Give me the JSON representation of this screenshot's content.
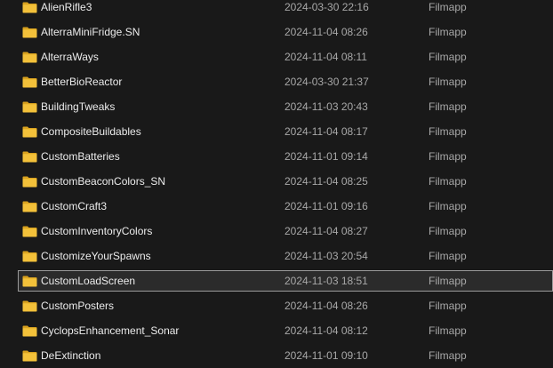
{
  "icon": "folder-icon",
  "colors": {
    "background": "#191919",
    "folder": "#f3c13a",
    "selection_border": "#9a9a9a"
  },
  "rows": [
    {
      "name": "AlienRifle3",
      "date": "2024-03-30 22:16",
      "type": "Filmapp"
    },
    {
      "name": "AlterraMiniFridge.SN",
      "date": "2024-11-04 08:26",
      "type": "Filmapp"
    },
    {
      "name": "AlterraWays",
      "date": "2024-11-04 08:11",
      "type": "Filmapp"
    },
    {
      "name": "BetterBioReactor",
      "date": "2024-03-30 21:37",
      "type": "Filmapp"
    },
    {
      "name": "BuildingTweaks",
      "date": "2024-11-03 20:43",
      "type": "Filmapp"
    },
    {
      "name": "CompositeBuildables",
      "date": "2024-11-04 08:17",
      "type": "Filmapp"
    },
    {
      "name": "CustomBatteries",
      "date": "2024-11-01 09:14",
      "type": "Filmapp"
    },
    {
      "name": "CustomBeaconColors_SN",
      "date": "2024-11-04 08:25",
      "type": "Filmapp"
    },
    {
      "name": "CustomCraft3",
      "date": "2024-11-01 09:16",
      "type": "Filmapp"
    },
    {
      "name": "CustomInventoryColors",
      "date": "2024-11-04 08:27",
      "type": "Filmapp"
    },
    {
      "name": "CustomizeYourSpawns",
      "date": "2024-11-03 20:54",
      "type": "Filmapp"
    },
    {
      "name": "CustomLoadScreen",
      "date": "2024-11-03 18:51",
      "type": "Filmapp",
      "selected": true
    },
    {
      "name": "CustomPosters",
      "date": "2024-11-04 08:26",
      "type": "Filmapp"
    },
    {
      "name": "CyclopsEnhancement_Sonar",
      "date": "2024-11-04 08:12",
      "type": "Filmapp"
    },
    {
      "name": "DeExtinction",
      "date": "2024-11-01 09:10",
      "type": "Filmapp"
    }
  ]
}
